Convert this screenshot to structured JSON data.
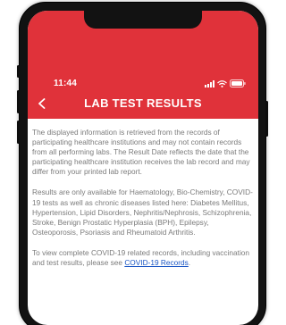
{
  "status_bar": {
    "time": "11:44",
    "icons": [
      "signal-icon",
      "wifi-icon",
      "battery-icon"
    ]
  },
  "header": {
    "title": "LAB TEST RESULTS",
    "back_icon": "chevron-left-icon",
    "color": "#e0323a"
  },
  "content": {
    "paragraph1": "The displayed information is retrieved from the records of participating healthcare institutions and may not contain records from all performing labs. The Result Date reflects the date that the participating healthcare institution receives the lab record and may differ from your printed lab report.",
    "paragraph2": "Results are only available for Haematology, Bio-Chemistry, COVID-19 tests as well as chronic diseases listed here: Diabetes Mellitus, Hypertension, Lipid Disorders, Nephritis/Nephrosis, Schizophrenia, Stroke, Benign Prostatic Hyperplasia (BPH), Epilepsy, Osteoporosis, Psoriasis and Rheumatoid Arthritis.",
    "paragraph3_prefix": "To view complete COVID-19 related records, including vaccination and test results, please see ",
    "paragraph3_link": "COVID-19 Records",
    "paragraph3_suffix": ".",
    "link_color": "#1a56c4"
  }
}
